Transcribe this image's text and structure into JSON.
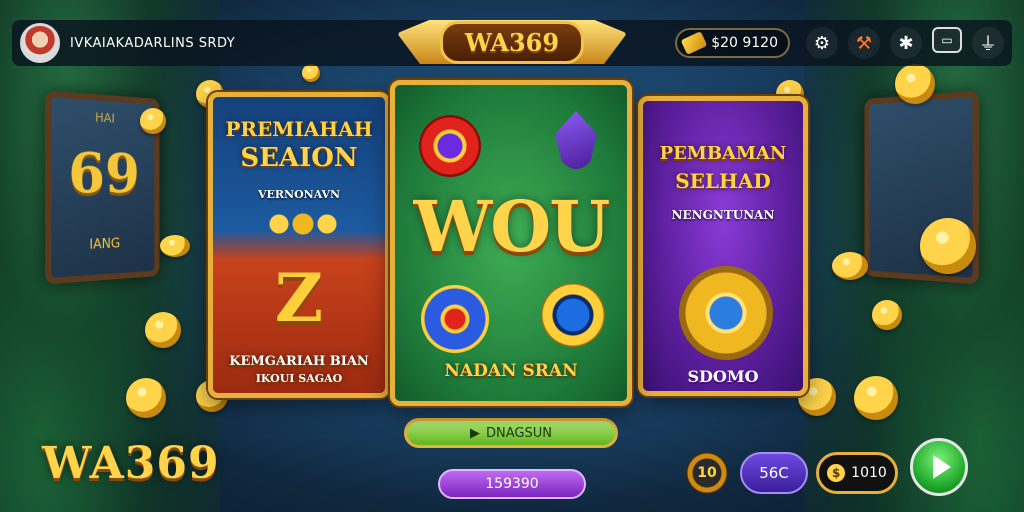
{
  "header": {
    "player_name": "IVKAIAKADARLINS SRDY",
    "brand_logo": "WA369",
    "balance": "$20 9120",
    "icons": [
      "settings-icon",
      "hammer-icon",
      "puzzle-icon",
      "chat-icon",
      "microphone-icon"
    ]
  },
  "side_boards": {
    "left": {
      "big": "69",
      "small": "IANG",
      "top": "HAI"
    }
  },
  "panels": {
    "left": {
      "title_line1": "PREMIAHAH",
      "title_line2": "SEAION",
      "subtitle": "VERNONAVN",
      "symbol": "Z",
      "bottom_line1": "KEMGARIAH BIAN",
      "bottom_line2": "IKOUI SAGAO"
    },
    "center": {
      "headline": "WOU",
      "bottom": "NADAN SRAN"
    },
    "right": {
      "title_line1": "PEMBAMAN",
      "title_line2": "SELHAD",
      "subtitle": "NENGNTUNAN",
      "bottom": "SDOMO"
    }
  },
  "buttons": {
    "green_spin_label": "DNAGSUN",
    "green_spin_icon": "play-icon",
    "purple_label": "159390"
  },
  "bottom_bar": {
    "logo": "WA369",
    "gear_value": "10",
    "bet_value": "56C",
    "win_value": "1010",
    "win_coin_symbol": "$"
  },
  "colors": {
    "gold": "#ffd34a",
    "frame": "#e7b03a",
    "green_button": "#5fb21e",
    "purple_button": "#7a24c0"
  }
}
